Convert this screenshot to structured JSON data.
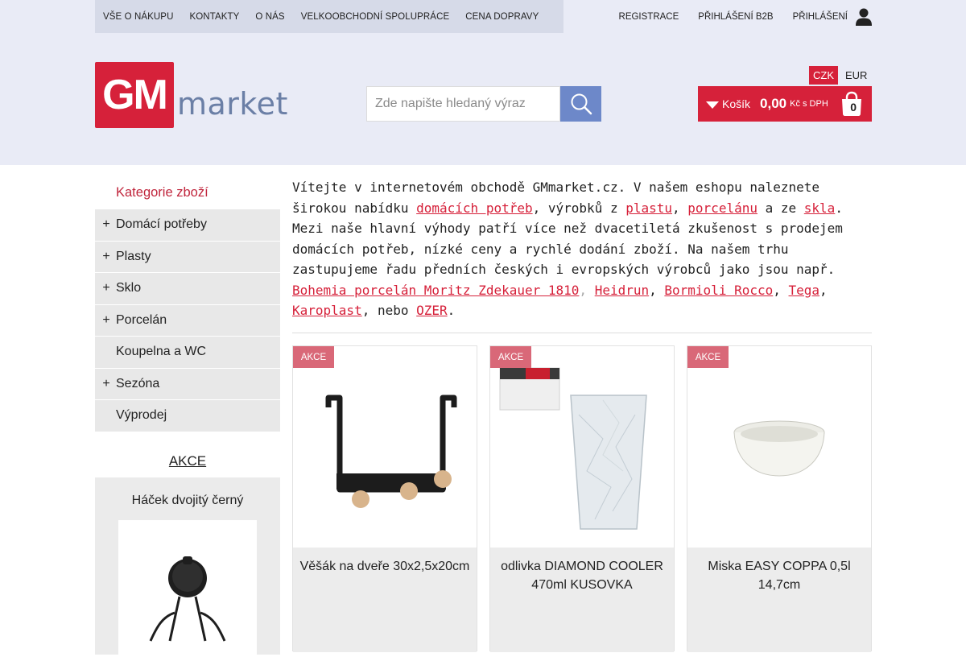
{
  "topnav": [
    "VŠE O NÁKUPU",
    "KONTAKTY",
    "O NÁS",
    "VELKOOBCHODNÍ SPOLUPRÁCE",
    "CENA DOPRAVY"
  ],
  "account": {
    "register": "REGISTRACE",
    "b2b_login": "PŘIHLÁŠENÍ B2B",
    "login": "PŘIHLÁŠENÍ",
    "icon": "user-icon"
  },
  "logo": {
    "mark": "GM",
    "word": "market"
  },
  "search": {
    "placeholder": "Zde napište hledaný výraz",
    "icon": "search-icon"
  },
  "currency": {
    "options": [
      "CZK",
      "EUR"
    ],
    "selected": "CZK"
  },
  "cart": {
    "label": "Košík",
    "amount": "0,00",
    "currency_note": "Kč s DPH",
    "count": "0",
    "icon": "shopping-bag-icon"
  },
  "sidebar": {
    "heading": "Kategorie zboží",
    "categories": [
      {
        "plus": "+",
        "label": "Domácí potřeby"
      },
      {
        "plus": "+",
        "label": "Plasty"
      },
      {
        "plus": "+",
        "label": "Sklo"
      },
      {
        "plus": "+",
        "label": "Porcelán"
      },
      {
        "plus": "",
        "label": "Koupelna a WC"
      },
      {
        "plus": "+",
        "label": "Sezóna"
      },
      {
        "plus": "",
        "label": "Výprodej"
      }
    ],
    "akce_link": "AKCE",
    "promo_name": "Háček dvojitý černý"
  },
  "intro": {
    "t1": "Vítejte v internetovém obchodě GMmarket.cz. V našem eshopu naleznete širokou nabídku ",
    "l1": "domácích potřeb",
    "t2": ", výrobků z ",
    "l2": "plastu",
    "t3": ", ",
    "l3": "porcelánu",
    "t4": " a ze ",
    "l4": "skla",
    "t5": ". Mezi naše hlavní výhody patří více než dvacetiletá zkušenost s prodejem domácích potřeb, nízké ceny a rychlé dodání zboží. Na našem trhu zastupujeme řadu předních českých i evropských výrobců jako jsou např. ",
    "l5": "Bohemia porcelán Moritz Zdekauer 1810",
    "t6": ", ",
    "l6": "Heidrun",
    "t7": ", ",
    "l7": "Bormioli Rocco",
    "t8": ", ",
    "l8": "Tega",
    "t9": ", ",
    "l9": "Karoplast",
    "t10": ", nebo ",
    "l10": "OZER",
    "t11": "."
  },
  "products": [
    {
      "badge": "AKCE",
      "name": "Věšák na dveře 30x2,5x20cm"
    },
    {
      "badge": "AKCE",
      "name": "odlivka DIAMOND COOLER 470ml KUSOVKA"
    },
    {
      "badge": "AKCE",
      "name": "Miska EASY COPPA 0,5l 14,7cm"
    }
  ],
  "colors": {
    "accent": "#d6213a",
    "search_button": "#6d88c9",
    "badge": "#d96878",
    "header_bg": "#e9ebf6"
  }
}
